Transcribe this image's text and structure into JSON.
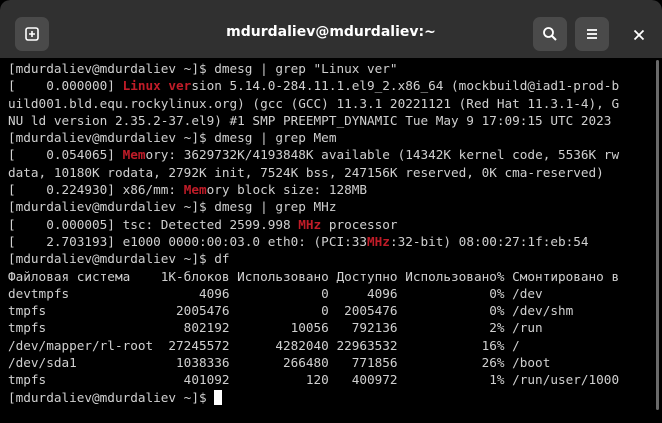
{
  "window": {
    "title": "mdurdaliev@mdurdaliev:~"
  },
  "icons": {
    "new_tab": "new-tab-icon",
    "search": "search-icon",
    "menu": "hamburger-menu-icon",
    "close": "close-icon"
  },
  "colors": {
    "highlight": "#c01c28",
    "text": "#d0d0d0",
    "background": "#000000",
    "titlebar": "#303030"
  },
  "terminal": {
    "lines": [
      [
        "[mdurdaliev@mdurdaliev ~]$ dmesg | grep \"Linux ver\""
      ],
      [
        "[    0.000000] ",
        {
          "hl": "Linux ver"
        },
        "sion 5.14.0-284.11.1.el9_2.x86_64 (mockbuild@iad1-prod-b"
      ],
      [
        "uild001.bld.equ.rockylinux.org) (gcc (GCC) 11.3.1 20221121 (Red Hat 11.3.1-4), G"
      ],
      [
        "NU ld version 2.35.2-37.el9) #1 SMP PREEMPT_DYNAMIC Tue May 9 17:09:15 UTC 2023"
      ],
      [
        "[mdurdaliev@mdurdaliev ~]$ dmesg | grep Mem"
      ],
      [
        "[    0.054065] ",
        {
          "hl": "Mem"
        },
        "ory: 3629732K/4193848K available (14342K kernel code, 5536K rw"
      ],
      [
        "data, 10180K rodata, 2792K init, 7524K bss, 247156K reserved, 0K cma-reserved)"
      ],
      [
        "[    0.224930] x86/mm: ",
        {
          "hl": "Mem"
        },
        "ory block size: 128MB"
      ],
      [
        "[mdurdaliev@mdurdaliev ~]$ dmesg | grep MHz"
      ],
      [
        "[    0.000005] tsc: Detected 2599.998 ",
        {
          "hl": "MHz"
        },
        " processor"
      ],
      [
        "[    2.703193] e1000 0000:00:03.0 eth0: (PCI:33",
        {
          "hl": "MHz"
        },
        ":32-bit) 08:00:27:1f:eb:54"
      ],
      [
        "[mdurdaliev@mdurdaliev ~]$ df"
      ],
      [
        "Файловая система    1K-блоков Использовано Доступно Использовано% Смонтировано в"
      ],
      [
        "devtmpfs                 4096            0     4096            0% /dev"
      ],
      [
        "tmpfs                 2005476            0  2005476            0% /dev/shm"
      ],
      [
        "tmpfs                  802192        10056   792136            2% /run"
      ],
      [
        "/dev/mapper/rl-root  27245572      4282040 22963532           16% /"
      ],
      [
        "/dev/sda1             1038336       266480   771856           26% /boot"
      ],
      [
        "tmpfs                  401092          120   400972            1% /run/user/1000"
      ],
      [
        "[mdurdaliev@mdurdaliev ~]$ "
      ]
    ],
    "cursor_on_last_line": true
  }
}
